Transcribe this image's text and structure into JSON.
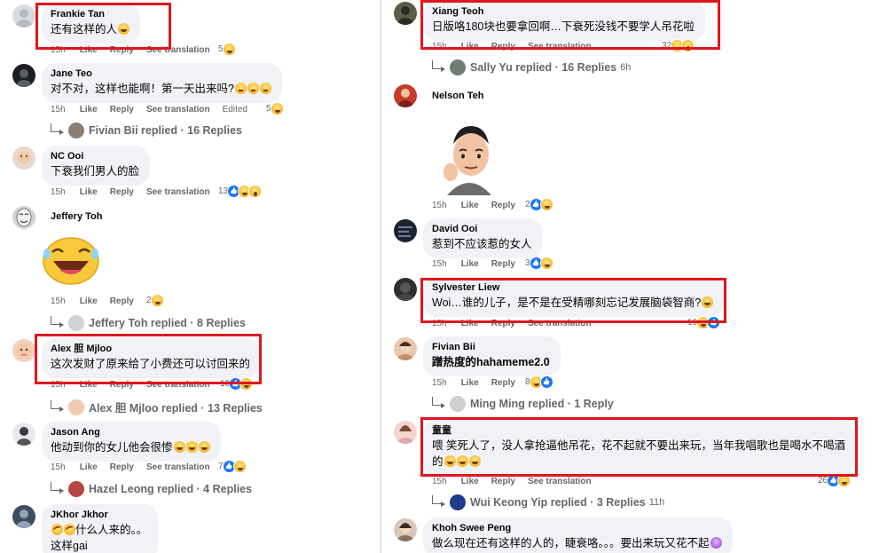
{
  "labels": {
    "like": "Like",
    "reply": "Reply",
    "see_translation": "See translation",
    "edited": "Edited"
  },
  "left_comments": [
    {
      "author": "Frankie Tan",
      "text": "还有这样的人",
      "time": "15h",
      "count": "5",
      "reply_summary": ""
    },
    {
      "author": "Jane Teo",
      "text": "对不对，这样也能啊！第一天出来吗?",
      "time": "15h",
      "count": "5",
      "reply_summary": "Fivian Bii replied · 16 Replies"
    },
    {
      "author": "NC Ooi",
      "text": "下衰我们男人的脸",
      "time": "15h",
      "count": "13",
      "reply_summary": ""
    },
    {
      "author": "Jeffery Toh",
      "text": "",
      "time": "15h",
      "count": "2",
      "reply_summary": "Jeffery Toh replied · 8 Replies"
    },
    {
      "author": "Alex 胆 Mjloo",
      "text": "这次发财了原来给了小费还可以讨回来的",
      "time": "15h",
      "count": "10",
      "reply_summary": "Alex 胆 Mjloo replied · 13 Replies"
    },
    {
      "author": "Jason Ang",
      "text": "他动到你的女儿他会很惨",
      "time": "15h",
      "count": "7",
      "reply_summary": "Hazel Leong replied · 4 Replies"
    },
    {
      "author": "JKhor Jkhor",
      "text": "什么人来的。。",
      "text2": "这样gai",
      "time": "",
      "count": "",
      "reply_summary": ""
    }
  ],
  "right_comments": [
    {
      "author": "Xiang Teoh",
      "text": "日版咯180块也要拿回啊…下衰死没钱不要学人吊花啦",
      "time": "15h",
      "count": "32",
      "reply_summary": "Sally Yu replied · 16 Replies",
      "reply_time": "6h"
    },
    {
      "author": "Nelson Teh",
      "text": "",
      "time": "15h",
      "count": "2",
      "reply_summary": ""
    },
    {
      "author": "David Ooi",
      "text": "惹到不应该惹的女人",
      "time": "15h",
      "count": "3",
      "reply_summary": ""
    },
    {
      "author": "Sylvester Liew",
      "text": "Woi…谁的儿子，是不是在受精哪刻忘记发展脑袋智商?",
      "time": "15h",
      "count": "16",
      "reply_summary": ""
    },
    {
      "author": "Fivian Bii",
      "text": "蹭热度的hahameme2.0",
      "time": "15h",
      "count": "8",
      "reply_summary": "Ming Ming replied · 1 Reply"
    },
    {
      "author": "童童",
      "text": "喂 笑死人了，没人拿抢逼他吊花，花不起就不要出来玩，当年我唱歌也是喝水不喝酒",
      "text2": "的",
      "time": "15h",
      "count": "26",
      "reply_summary": "Wui Keong Yip replied · 3 Replies",
      "reply_time": "11h"
    },
    {
      "author": "Khoh Swee Peng",
      "text": "做么现在还有这样的人的，睫衰咯。。。要出来玩又花不起",
      "time": "",
      "count": "",
      "reply_summary": ""
    }
  ],
  "colors": {
    "highlight": "#e0161c",
    "bubble": "#f0f2f5",
    "meta_text": "#65676b",
    "like_blue": "#1877f2"
  }
}
